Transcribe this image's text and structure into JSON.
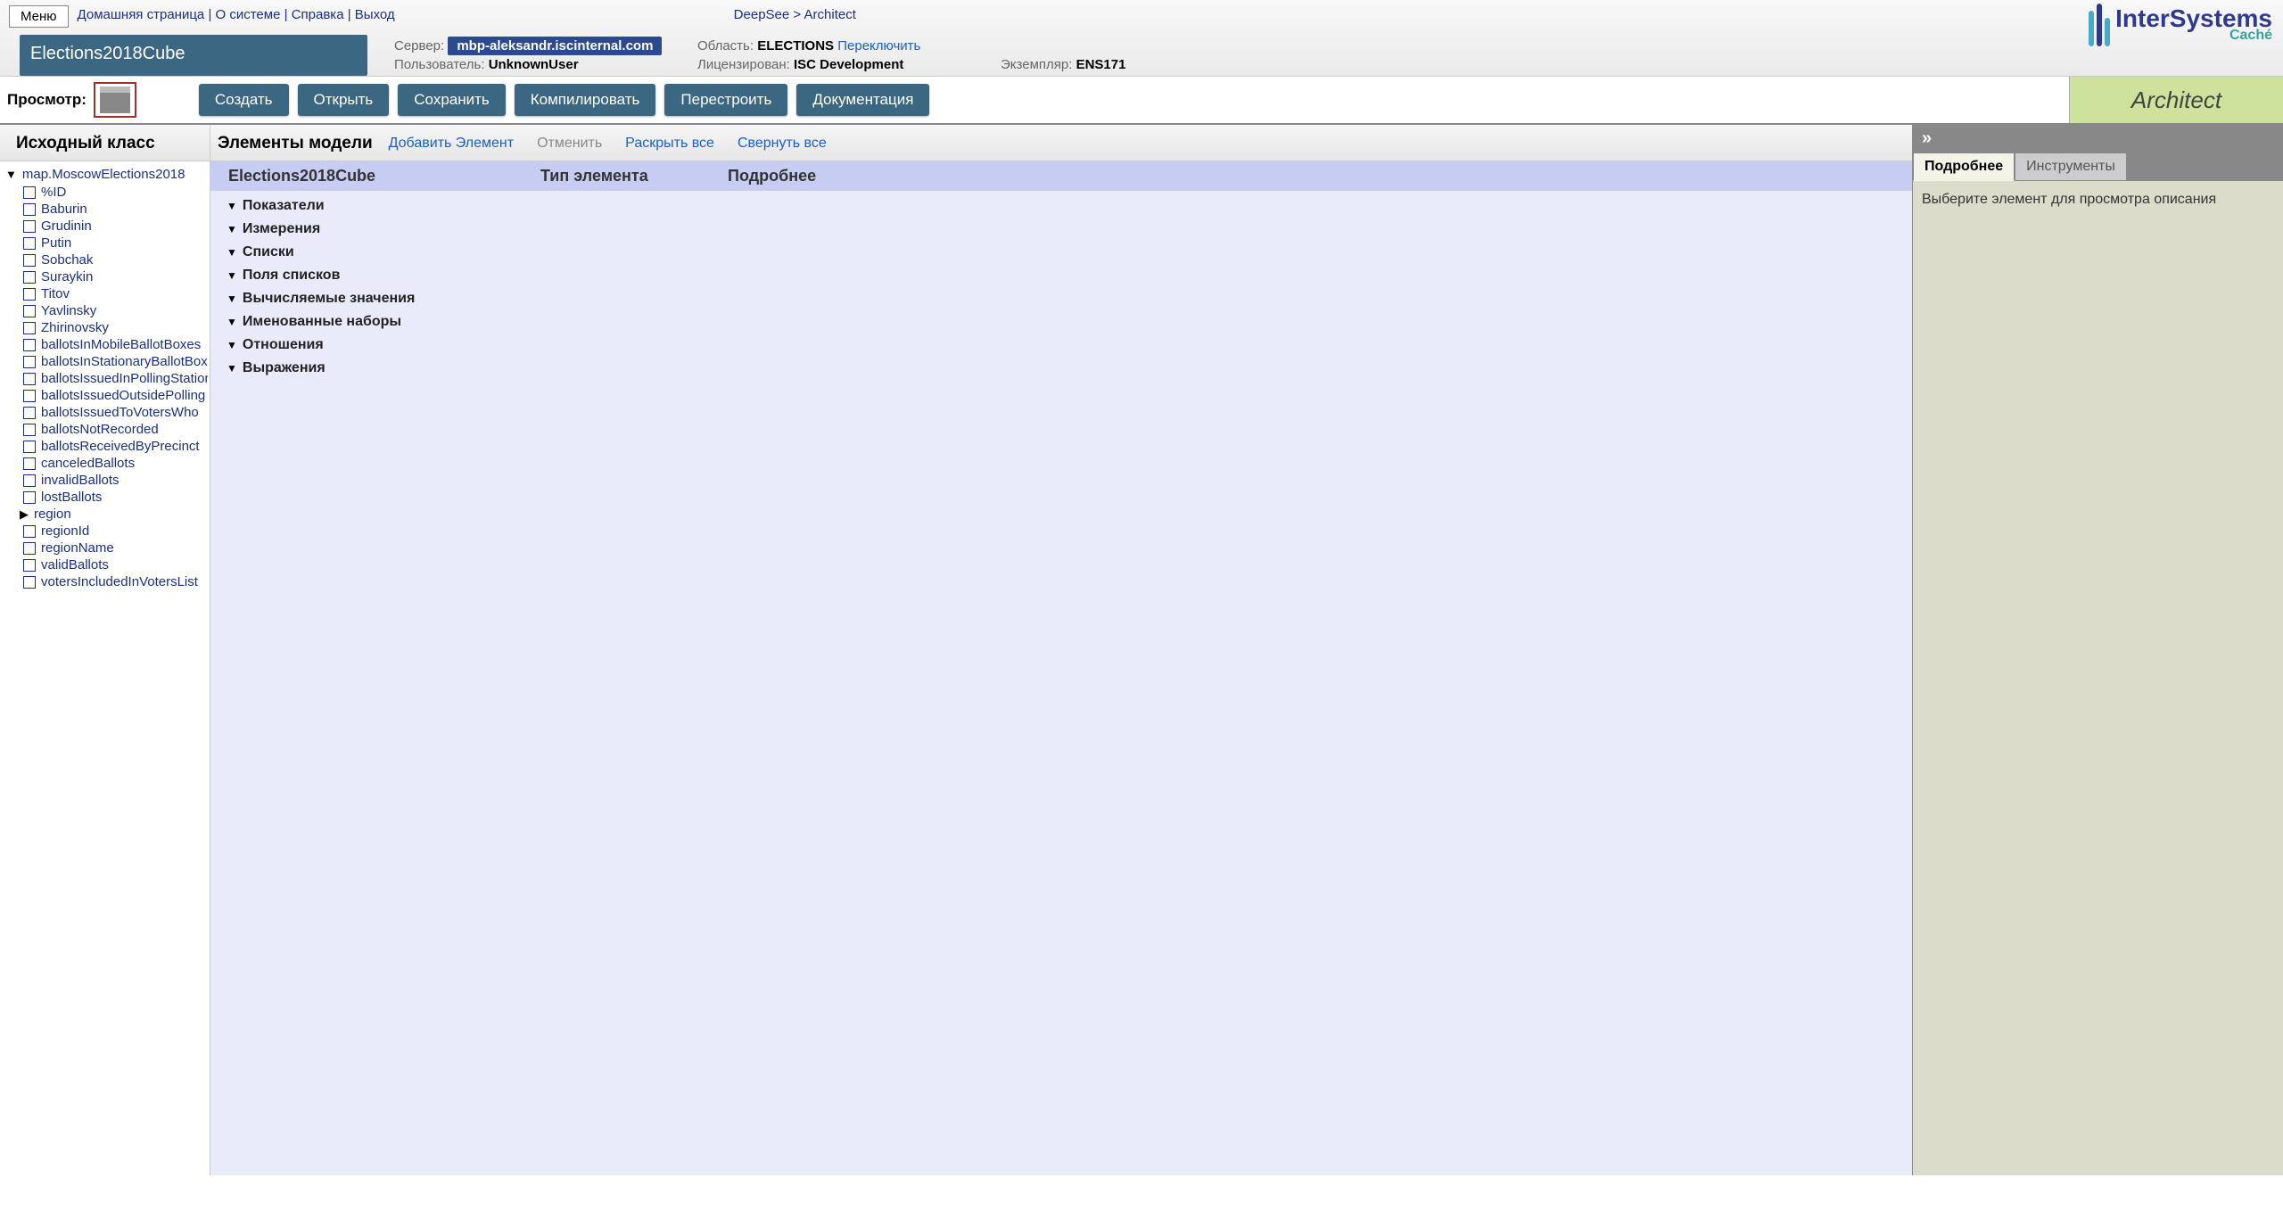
{
  "menu_button": "Меню",
  "nav_links": [
    "Домашняя страница",
    "О системе",
    "Справка",
    "Выход"
  ],
  "breadcrumb": {
    "root": "DeepSee",
    "sep": ">",
    "current": "Architect"
  },
  "cube_title": "Elections2018Cube",
  "header_info": {
    "server_label": "Сервер:",
    "server_value": "mbp-aleksandr.iscinternal.com",
    "user_label": "Пользователь:",
    "user_value": "UnknownUser",
    "domain_label": "Область:",
    "domain_value": "ELECTIONS",
    "switch": "Переключить",
    "license_label": "Лицензирован:",
    "license_value": "ISC Development",
    "instance_label": "Экземпляр:",
    "instance_value": "ENS171"
  },
  "logo": {
    "brand": "InterSystems",
    "product": "Caché"
  },
  "view_label": "Просмотр:",
  "toolbar_buttons": [
    "Создать",
    "Открыть",
    "Сохранить",
    "Компилировать",
    "Перестроить",
    "Документация"
  ],
  "arch_label": "Architect",
  "left_header": "Исходный класс",
  "tree_root": "map.MoscowElections2018",
  "tree_items": [
    {
      "label": "%ID",
      "type": "box"
    },
    {
      "label": "Baburin",
      "type": "box"
    },
    {
      "label": "Grudinin",
      "type": "box"
    },
    {
      "label": "Putin",
      "type": "box"
    },
    {
      "label": "Sobchak",
      "type": "box"
    },
    {
      "label": "Suraykin",
      "type": "box"
    },
    {
      "label": "Titov",
      "type": "box"
    },
    {
      "label": "Yavlinsky",
      "type": "box"
    },
    {
      "label": "Zhirinovsky",
      "type": "box"
    },
    {
      "label": "ballotsInMobileBallotBoxes",
      "type": "box"
    },
    {
      "label": "ballotsInStationaryBallotBoxes",
      "type": "box"
    },
    {
      "label": "ballotsIssuedInPollingStation",
      "type": "box"
    },
    {
      "label": "ballotsIssuedOutsidePolling",
      "type": "box"
    },
    {
      "label": "ballotsIssuedToVotersWho",
      "type": "box"
    },
    {
      "label": "ballotsNotRecorded",
      "type": "box"
    },
    {
      "label": "ballotsReceivedByPrecinct",
      "type": "box"
    },
    {
      "label": "canceledBallots",
      "type": "box"
    },
    {
      "label": "invalidBallots",
      "type": "box"
    },
    {
      "label": "lostBallots",
      "type": "box"
    },
    {
      "label": "region",
      "type": "arrow"
    },
    {
      "label": "regionId",
      "type": "box"
    },
    {
      "label": "regionName",
      "type": "box"
    },
    {
      "label": "validBallots",
      "type": "box"
    },
    {
      "label": "votersIncludedInVotersList",
      "type": "box"
    }
  ],
  "mid_header": {
    "title": "Элементы модели",
    "add": "Добавить Элемент",
    "cancel": "Отменить",
    "expand": "Раскрыть все",
    "collapse": "Свернуть все"
  },
  "mid_sub": {
    "c1": "Elections2018Cube",
    "c2": "Тип элемента",
    "c3": "Подробнее"
  },
  "categories": [
    "Показатели",
    "Измерения",
    "Списки",
    "Поля списков",
    "Вычисляемые значения",
    "Именованные наборы",
    "Отношения",
    "Выражения"
  ],
  "right": {
    "expand_icon": "»",
    "tab_details": "Подробнее",
    "tab_tools": "Инструменты",
    "body_text": "Выберите элемент для просмотра описания"
  }
}
